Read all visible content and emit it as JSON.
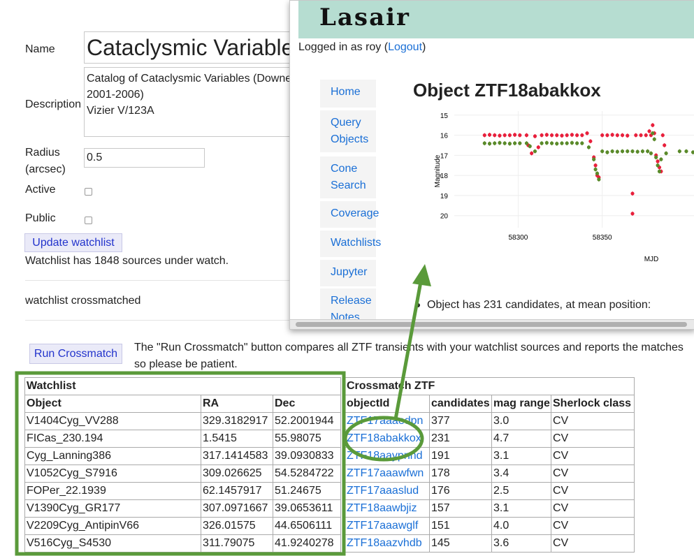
{
  "form": {
    "name_label": "Name",
    "name_value": "Cataclysmic Variables",
    "description_label": "Description",
    "description_lines": [
      "Catalog of Cataclysmic Variables (Downes",
      "2001-2006)",
      "Vizier V/123A"
    ],
    "radius_label_1": "Radius",
    "radius_label_2": "(arcsec)",
    "radius_value": "0.5",
    "active_label": "Active",
    "public_label": "Public",
    "update_button": "Update watchlist",
    "sources_text": "Watchlist has 1848 sources under watch.",
    "crossmatched_text": "watchlist crossmatched",
    "run_button": "Run Crossmatch",
    "run_desc_line1": "The \"Run Crossmatch\" button compares all ZTF transients with your watchlist sources and reports the matches",
    "run_desc_line2": "so please be patient."
  },
  "watchlist_table": {
    "title": "Watchlist",
    "columns": [
      "Object",
      "RA",
      "Dec"
    ],
    "rows": [
      [
        "V1404Cyg_VV288",
        "329.3182917",
        "52.2001944"
      ],
      [
        "FICas_230.194",
        "1.5415",
        "55.98075"
      ],
      [
        "Cyg_Lanning386",
        "317.1414583",
        "39.0930833"
      ],
      [
        "V1052Cyg_S7916",
        "309.026625",
        "54.5284722"
      ],
      [
        "FOPer_22.1939",
        "62.1457917",
        "51.24675"
      ],
      [
        "V1390Cyg_GR177",
        "307.0971667",
        "39.0653611"
      ],
      [
        "V2209Cyg_AntipinV66",
        "326.01575",
        "44.6506111"
      ],
      [
        "V516Cyg_S4530",
        "311.79075",
        "41.9240278"
      ]
    ]
  },
  "crossmatch_table": {
    "title": "Crossmatch ZTF",
    "columns": [
      "objectId",
      "candidates",
      "mag range",
      "Sherlock class"
    ],
    "rows": [
      [
        "ZTF17aaaedpn",
        "377",
        "3.0",
        "CV"
      ],
      [
        "ZTF18abakkox",
        "231",
        "4.7",
        "CV"
      ],
      [
        "ZTF18aaypnnd",
        "191",
        "3.1",
        "CV"
      ],
      [
        "ZTF17aaawfwn",
        "178",
        "3.4",
        "CV"
      ],
      [
        "ZTF17aaaslud",
        "176",
        "2.5",
        "CV"
      ],
      [
        "ZTF18aawbjiz",
        "157",
        "3.1",
        "CV"
      ],
      [
        "ZTF17aaawglf",
        "151",
        "4.0",
        "CV"
      ],
      [
        "ZTF18aazvhdb",
        "145",
        "3.6",
        "CV"
      ]
    ]
  },
  "overlay": {
    "logo": "Lasair",
    "logged_in_prefix": "Logged in as roy (",
    "logout": "Logout",
    "logged_in_suffix": ")",
    "nav": [
      [
        "Home"
      ],
      [
        "Query",
        "Objects"
      ],
      [
        "Cone",
        "Search"
      ],
      [
        "Coverage"
      ],
      [
        "Watchlists"
      ],
      [
        "Jupyter"
      ],
      [
        "Release",
        "Notes"
      ]
    ],
    "object_title": "Object ZTF18abakkox",
    "bullet_text": "Object has 231 candidates, at mean position:"
  },
  "colors": {
    "header_bg": "#b6ddd1",
    "highlight": "#5a9a3a",
    "red_series": "#e8203c",
    "green_series": "#5a8a2a",
    "link": "#1a6fd6"
  },
  "chart_data": {
    "type": "scatter",
    "xlabel": "MJD",
    "ylabel": "Magnitude",
    "x_ticks": [
      58300,
      58350
    ],
    "y_ticks": [
      15,
      16,
      17,
      18,
      19,
      20
    ],
    "xlim": [
      58262,
      58405
    ],
    "ylim": [
      20.6,
      14.8
    ],
    "y_inverted": true,
    "series": [
      {
        "color": "#e8203c",
        "points": [
          [
            58280,
            16.0
          ],
          [
            58283,
            15.98
          ],
          [
            58286,
            16.0
          ],
          [
            58289,
            16.02
          ],
          [
            58292,
            16.0
          ],
          [
            58295,
            16.0
          ],
          [
            58298,
            15.98
          ],
          [
            58301,
            16.0
          ],
          [
            58305,
            16.0
          ],
          [
            58306,
            16.5
          ],
          [
            58308,
            16.9
          ],
          [
            58310,
            16.05
          ],
          [
            58312,
            16.6
          ],
          [
            58314,
            16.0
          ],
          [
            58317,
            15.98
          ],
          [
            58320,
            16.0
          ],
          [
            58323,
            16.0
          ],
          [
            58326,
            16.02
          ],
          [
            58329,
            16.0
          ],
          [
            58332,
            15.98
          ],
          [
            58335,
            16.0
          ],
          [
            58338,
            16.0
          ],
          [
            58341,
            15.9
          ],
          [
            58343,
            16.3
          ],
          [
            58345,
            17.1
          ],
          [
            58346,
            17.5
          ],
          [
            58347,
            18.0
          ],
          [
            58348,
            18.1
          ],
          [
            58350,
            16.0
          ],
          [
            58353,
            16.0
          ],
          [
            58356,
            15.98
          ],
          [
            58359,
            16.0
          ],
          [
            58362,
            16.0
          ],
          [
            58365,
            16.02
          ],
          [
            58368,
            19.9
          ],
          [
            58370,
            16.0
          ],
          [
            58373,
            16.0
          ],
          [
            58376,
            16.0
          ],
          [
            58378,
            15.8
          ],
          [
            58379,
            16.0
          ],
          [
            58380,
            15.5
          ],
          [
            58381,
            15.9
          ],
          [
            58382,
            17.0
          ],
          [
            58383,
            17.3
          ],
          [
            58384,
            17.6
          ],
          [
            58385,
            17.8
          ],
          [
            58386,
            16.0
          ],
          [
            58387,
            16.5
          ],
          [
            58368,
            18.9
          ]
        ]
      },
      {
        "color": "#5a8a2a",
        "points": [
          [
            58280,
            16.4
          ],
          [
            58283,
            16.42
          ],
          [
            58286,
            16.4
          ],
          [
            58289,
            16.38
          ],
          [
            58292,
            16.4
          ],
          [
            58295,
            16.42
          ],
          [
            58298,
            16.4
          ],
          [
            58301,
            16.4
          ],
          [
            58305,
            16.4
          ],
          [
            58307,
            16.55
          ],
          [
            58310,
            16.8
          ],
          [
            58314,
            16.4
          ],
          [
            58317,
            16.38
          ],
          [
            58320,
            16.4
          ],
          [
            58323,
            16.42
          ],
          [
            58326,
            16.4
          ],
          [
            58329,
            16.4
          ],
          [
            58332,
            16.38
          ],
          [
            58335,
            16.4
          ],
          [
            58338,
            16.4
          ],
          [
            58342,
            16.6
          ],
          [
            58345,
            17.2
          ],
          [
            58346,
            17.7
          ],
          [
            58347,
            17.9
          ],
          [
            58348,
            18.2
          ],
          [
            58350,
            16.8
          ],
          [
            58353,
            16.85
          ],
          [
            58356,
            16.8
          ],
          [
            58359,
            16.82
          ],
          [
            58362,
            16.8
          ],
          [
            58365,
            16.8
          ],
          [
            58368,
            16.8
          ],
          [
            58371,
            16.82
          ],
          [
            58374,
            16.8
          ],
          [
            58377,
            16.8
          ],
          [
            58379,
            16.9
          ],
          [
            58380,
            15.9
          ],
          [
            58381,
            16.2
          ],
          [
            58382,
            17.1
          ],
          [
            58383,
            17.5
          ],
          [
            58384,
            17.8
          ],
          [
            58385,
            17.2
          ],
          [
            58388,
            16.9
          ],
          [
            58396,
            16.8
          ],
          [
            58400,
            16.8
          ],
          [
            58404,
            16.85
          ]
        ]
      }
    ]
  }
}
